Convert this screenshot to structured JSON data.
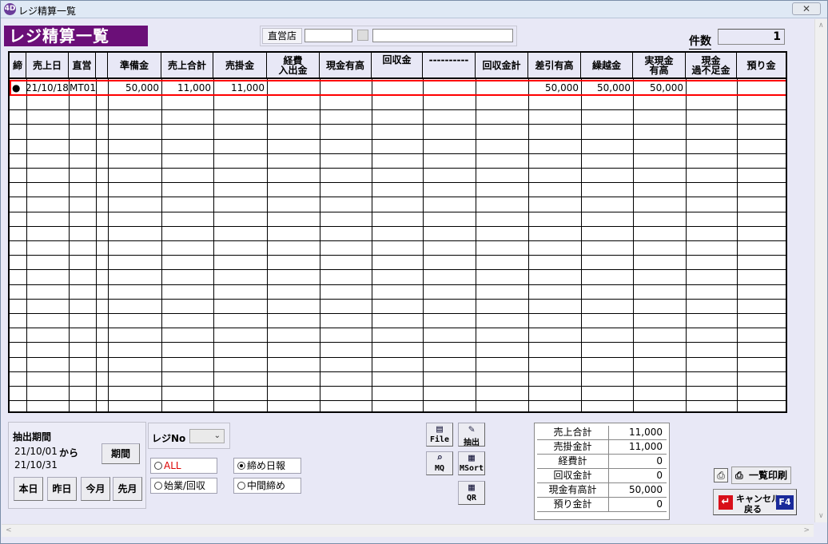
{
  "window": {
    "title": "レジ精算一覧",
    "app_badge": "4D"
  },
  "header": {
    "page_title": "レジ精算一覧",
    "store_label": "直営店",
    "count_label": "件数",
    "count_value": "1"
  },
  "grid": {
    "columns": [
      "締",
      "売上日",
      "直営",
      "",
      "準備金",
      "売上合計",
      "売掛金",
      "経費\n入出金",
      "現金有高",
      "回収金",
      "----------",
      "回収金計",
      "差引有高",
      "繰越金",
      "実現金\n有高",
      "現金\n過不足金",
      "預り金"
    ],
    "rows": [
      {
        "mark": "●",
        "date": "21/10/18",
        "store": "MT01",
        "reserve": "50,000",
        "sales_total": "11,000",
        "receivable": "11,000",
        "diff": "50,000",
        "carryover": "50,000",
        "actual_cash": "50,000"
      }
    ]
  },
  "period_panel": {
    "title": "抽出期間",
    "from_date": "21/10/01",
    "from_suffix": "から",
    "to_date": "21/10/31",
    "period_button": "期間",
    "buttons": [
      "本日",
      "昨日",
      "今月",
      "先月"
    ]
  },
  "filters": {
    "register_no_label": "レジNo",
    "radio_all": "ALL",
    "radio_start": "始業/回収",
    "radio_closing": "締め日報",
    "radio_interim": "中間締め"
  },
  "tools": {
    "file": "File",
    "extract": "抽出",
    "mq": "MQ",
    "msort": "MSort",
    "qr": "QR"
  },
  "summary": [
    {
      "label": "売上合計",
      "value": "11,000"
    },
    {
      "label": "売掛金計",
      "value": "11,000"
    },
    {
      "label": "経費計",
      "value": "0"
    },
    {
      "label": "回収金計",
      "value": "0"
    },
    {
      "label": "現金有高計",
      "value": "50,000"
    },
    {
      "label": "預り金計",
      "value": "0"
    }
  ],
  "actions": {
    "print_label": "一覧印刷",
    "cancel_line1": "キャンセル",
    "cancel_line2": "戻る",
    "cancel_key": "F4"
  },
  "colors": {
    "title_bg": "#6b0f78",
    "highlight": "#ff0000",
    "f4_badge": "#1a2a9a"
  }
}
